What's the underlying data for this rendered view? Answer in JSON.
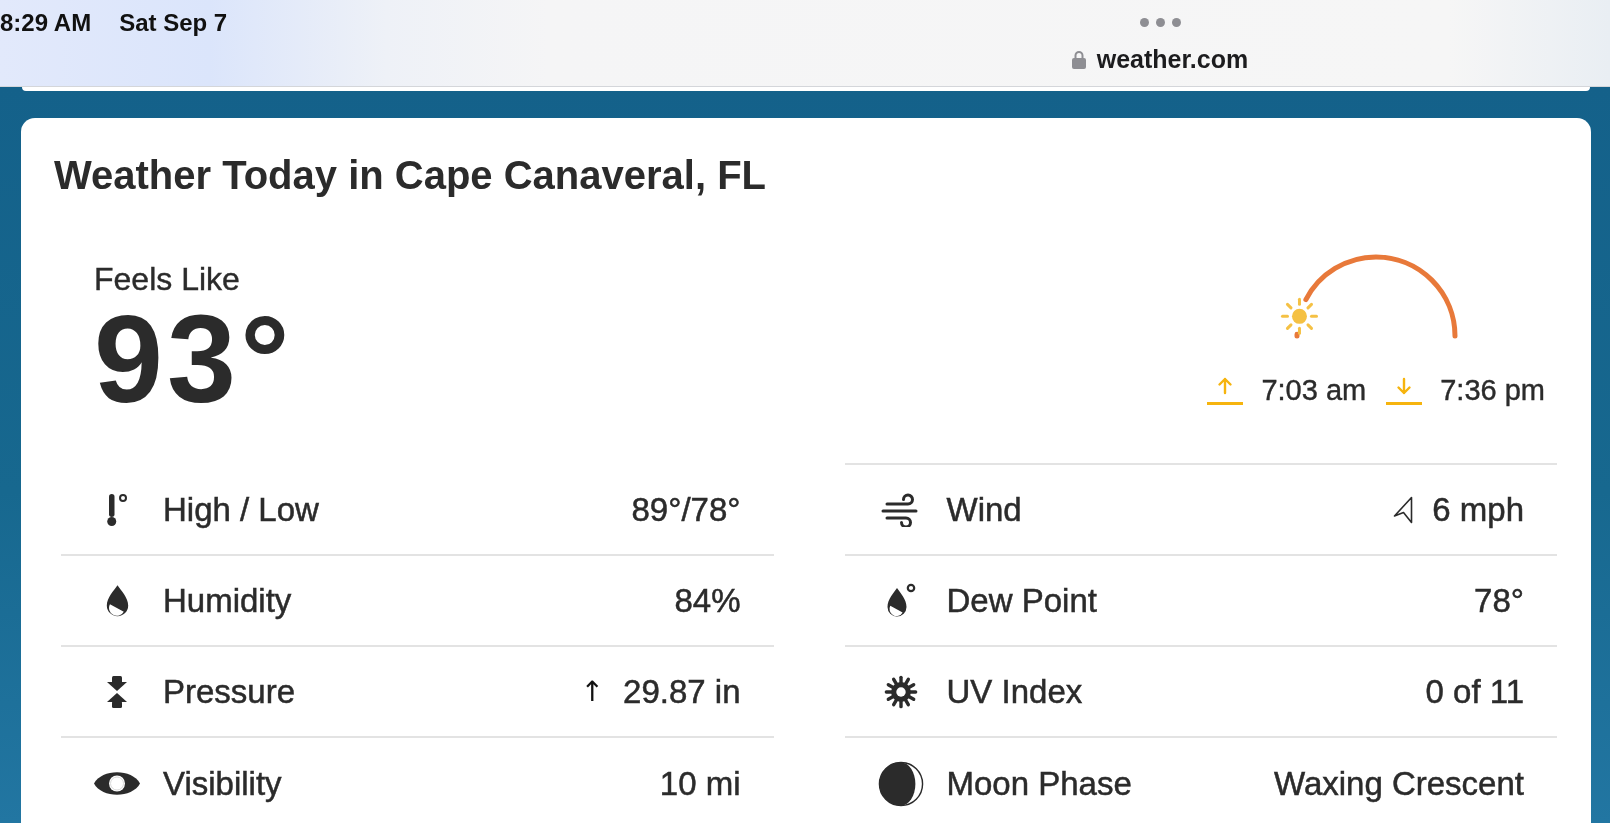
{
  "status_bar": {
    "time": "8:29 AM",
    "date": "Sat Sep 7"
  },
  "address_bar": {
    "url": "weather.com"
  },
  "card": {
    "title": "Weather Today in Cape Canaveral, FL",
    "feels_like": {
      "label": "Feels Like",
      "value": "93°"
    },
    "sun": {
      "level": 0.08,
      "sunrise": "7:03 am",
      "sunset": "7:36 pm"
    },
    "details": [
      {
        "rows": [
          {
            "kind": "high_low",
            "label": "High / Low",
            "value": "89°/78°"
          },
          {
            "kind": "humidity",
            "label": "Humidity",
            "value": "84%"
          },
          {
            "kind": "pressure",
            "label": "Pressure",
            "trend_arrow": "↑",
            "value": "29.87 in"
          },
          {
            "kind": "visibility",
            "label": "Visibility",
            "value": "10 mi"
          }
        ]
      },
      {
        "rows": [
          {
            "kind": "wind",
            "label": "Wind",
            "value": "6 mph"
          },
          {
            "kind": "dew_point",
            "label": "Dew Point",
            "value": "78°"
          },
          {
            "kind": "uv_index",
            "label": "UV Index",
            "value": "0 of 11"
          },
          {
            "kind": "moon_phase",
            "label": "Moon Phase",
            "value": "Waxing Crescent"
          }
        ]
      }
    ]
  }
}
